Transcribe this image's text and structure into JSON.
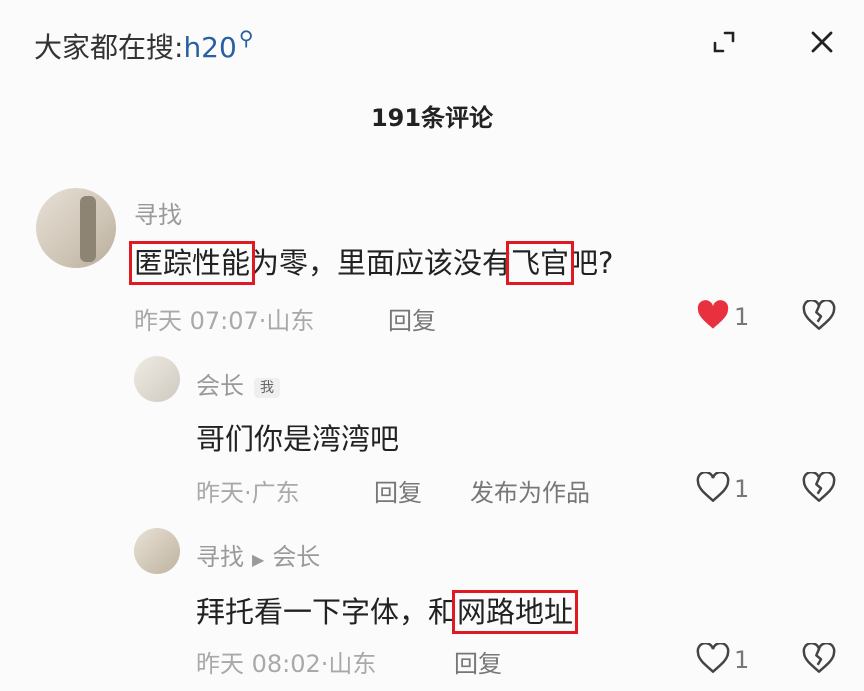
{
  "header": {
    "search_prefix": "大家都在搜:",
    "search_term": "h20",
    "search_icon": "search-icon",
    "expand_icon": "expand-icon",
    "close_icon": "close-icon"
  },
  "comment_count_label": "191条评论",
  "comments": [
    {
      "user": "寻找",
      "text_parts": [
        "匿踪性能",
        "为零，里面应该没有",
        "飞官",
        "吧?"
      ],
      "highlighted_parts": [
        0,
        2
      ],
      "time": "昨天 07:07·山东",
      "reply_label": "回复",
      "likes": "1",
      "liked": true
    },
    {
      "user": "会长",
      "badge": "我",
      "text": "哥们你是湾湾吧",
      "time": "昨天·广东",
      "reply_label": "回复",
      "publish_label": "发布为作品",
      "likes": "1",
      "liked": false
    },
    {
      "user": "寻找",
      "reply_to": "会长",
      "text_parts": [
        "拜托看一下字体，和",
        "网路地址"
      ],
      "highlighted_parts": [
        1
      ],
      "time": "昨天 08:02·山东",
      "reply_label": "回复",
      "likes": "1",
      "liked": false
    }
  ],
  "colors": {
    "highlight_box": "#e01a22",
    "liked_heart": "#e8303e",
    "search_term": "#2a5fa3"
  }
}
